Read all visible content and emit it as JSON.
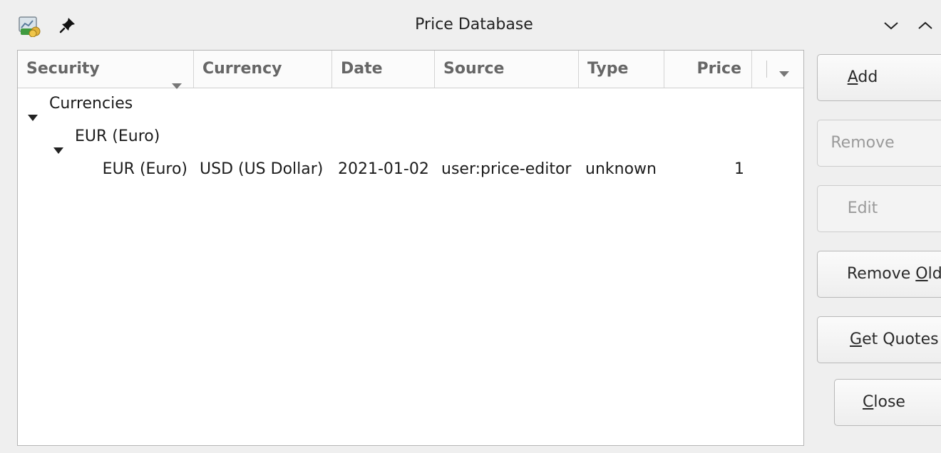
{
  "window": {
    "title": "Price Database"
  },
  "table": {
    "columns": [
      "Security",
      "Currency",
      "Date",
      "Source",
      "Type",
      "Price"
    ],
    "tree": {
      "group_label": "Currencies",
      "subgroup_label": "EUR (Euro)",
      "row": {
        "security": "EUR (Euro)",
        "currency": "USD (US Dollar)",
        "date": "2021-01-02",
        "source": "user:price-editor",
        "type": "unknown",
        "price": "1"
      }
    }
  },
  "buttons": {
    "add": {
      "pre": "",
      "mn": "A",
      "post": "dd",
      "enabled": true
    },
    "remove": {
      "label": "Remove",
      "enabled": false
    },
    "edit": {
      "label": "Edit",
      "enabled": false
    },
    "remove_old": {
      "pre": "Remove ",
      "mn": "O",
      "post": "ld",
      "enabled": true
    },
    "get_quotes": {
      "pre": "",
      "mn": "G",
      "post": "et Quotes",
      "enabled": true
    },
    "close": {
      "pre": "",
      "mn": "C",
      "post": "lose",
      "enabled": true
    }
  },
  "icons": {
    "app": "finance-app-icon",
    "pin": "pin-icon",
    "minimize": "chevron-down-icon",
    "maximize": "chevron-up-icon",
    "sort": "sort-down-icon",
    "expander": "triangle-down-icon"
  }
}
